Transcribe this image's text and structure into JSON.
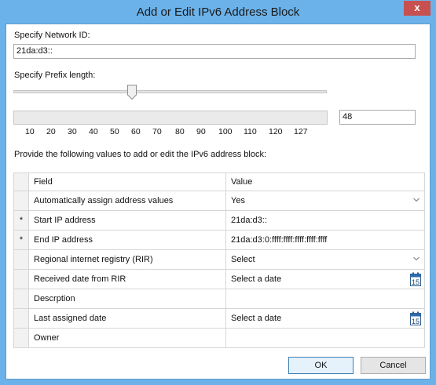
{
  "window": {
    "title": "Add or Edit IPv6 Address Block",
    "close_glyph": "x"
  },
  "network_id": {
    "label": "Specify Network ID:",
    "value": "21da:d3::"
  },
  "prefix": {
    "label": "Specify Prefix length:",
    "value": "48",
    "slider_fraction": 0.375,
    "ticks": [
      "10",
      "20",
      "30",
      "40",
      "50",
      "60",
      "70",
      "80",
      "90",
      "100",
      "110",
      "120",
      "127"
    ]
  },
  "instructions": "Provide the following values to add or edit the IPv6 address block:",
  "grid": {
    "headers": {
      "field": "Field",
      "value": "Value"
    },
    "rows": [
      {
        "marker": "",
        "field": "Automatically assign address values",
        "value": "Yes",
        "control": "dropdown"
      },
      {
        "marker": "*",
        "field": "Start IP address",
        "value": "21da:d3::",
        "control": "text"
      },
      {
        "marker": "*",
        "field": "End IP address",
        "value": "21da:d3:0:ffff:ffff:ffff:ffff:ffff",
        "control": "text"
      },
      {
        "marker": "",
        "field": "Regional internet registry (RIR)",
        "value": "Select",
        "control": "dropdown"
      },
      {
        "marker": "",
        "field": "Received date from RIR",
        "value": "Select a date",
        "control": "date"
      },
      {
        "marker": "",
        "field": "Descrption",
        "value": "",
        "control": "text"
      },
      {
        "marker": "",
        "field": "Last assigned date",
        "value": "Select a date",
        "control": "date"
      },
      {
        "marker": "",
        "field": "Owner",
        "value": "",
        "control": "text"
      }
    ]
  },
  "calendar_icon": {
    "name": "calendar-icon",
    "day": "15"
  },
  "buttons": {
    "ok": "OK",
    "cancel": "Cancel"
  }
}
